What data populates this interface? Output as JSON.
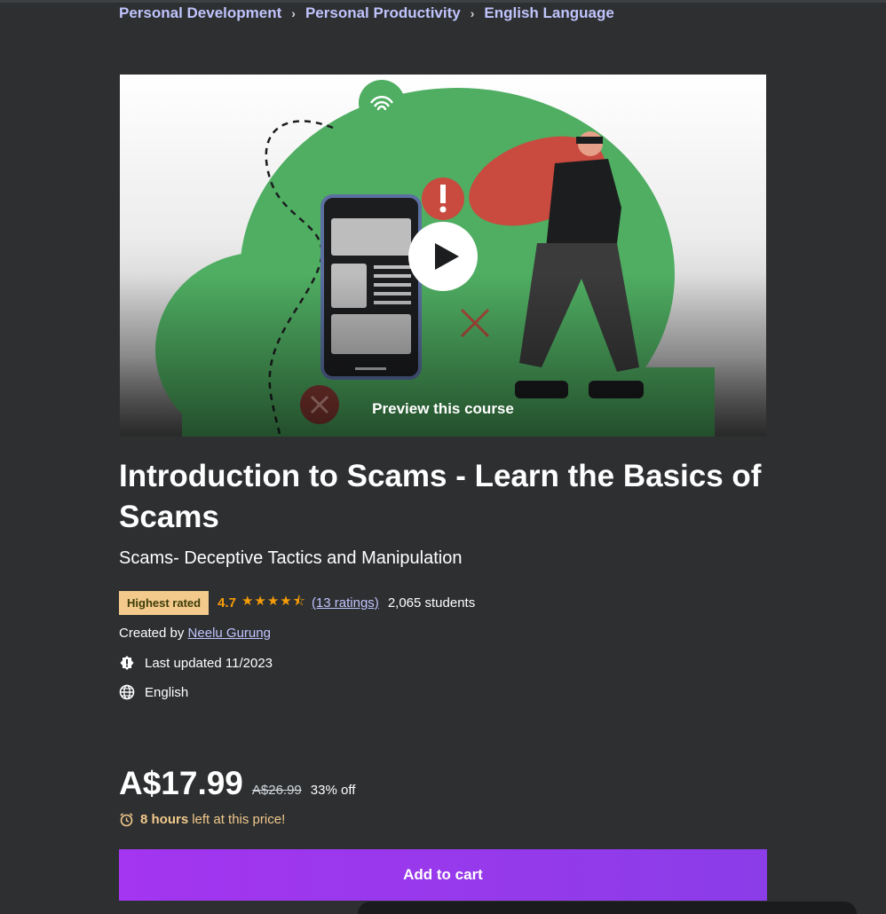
{
  "breadcrumb": {
    "items": [
      "Personal Development",
      "Personal Productivity",
      "English Language"
    ],
    "separator": "›"
  },
  "preview": {
    "label": "Preview this course"
  },
  "course": {
    "title": "Introduction to Scams - Learn the Basics of Scams",
    "subtitle": "Scams- Deceptive Tactics and Manipulation",
    "badge": "Highest rated",
    "rating": "4.7",
    "stars": "★★★★⯪",
    "ratings_link": "(13 ratings)",
    "students": "2,065 students",
    "created_prefix": "Created by",
    "instructor": "Neelu Gurung",
    "last_updated": "Last updated 11/2023",
    "language": "English"
  },
  "pricing": {
    "price": "A$17.99",
    "original_price": "A$26.99",
    "discount": "33% off",
    "timer_bold": "8 hours",
    "timer_rest": "left at this price!"
  },
  "cta": {
    "add_to_cart": "Add to cart"
  },
  "colors": {
    "background": "#2d2f31",
    "link": "#c0c4fc",
    "star": "#f69c08",
    "badge": "#f3ca8c",
    "cta": "#a435f0"
  }
}
